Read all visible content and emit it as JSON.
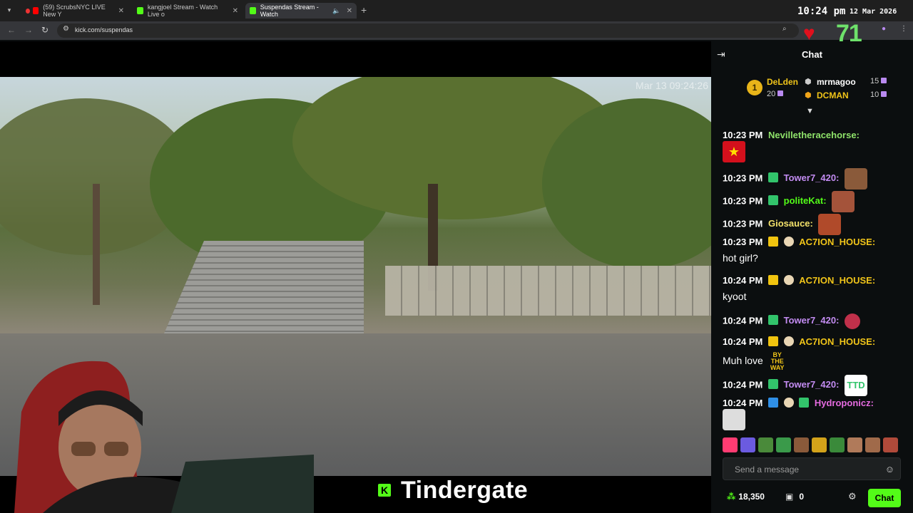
{
  "browser": {
    "tabs": [
      {
        "label": "(59) ScrubsNYC LIVE New Y",
        "icon": "youtube-icon"
      },
      {
        "label": "kangjoel Stream - Watch Live o",
        "icon": "kick-icon"
      },
      {
        "label": "Suspendas Stream - Watch",
        "icon": "kick-icon"
      }
    ],
    "url": "kick.com/suspendas",
    "clock": "10:24 pm",
    "date": "12 Mar 2026"
  },
  "overlay": {
    "viewers": "71",
    "video_timestamp": "Mar 13 09:24:26",
    "banner_text": "Tindergate",
    "colors": {
      "heart": "#e0101d",
      "viewers": "#6ee26b",
      "kick_green": "#53fc18"
    }
  },
  "chat": {
    "title": "Chat",
    "leaderboard": [
      {
        "rank": "1",
        "name": "DeLden",
        "count": "20",
        "color": "#f0c419"
      },
      {
        "name": "mrmagoo",
        "count": "15",
        "color": "#ffffff"
      },
      {
        "name": "DCMAN",
        "count": "10",
        "color": "#f0c419"
      }
    ],
    "messages": [
      {
        "time": "10:23 PM",
        "user": "Nevilletheracehorse:",
        "color": "#8fe36a",
        "text": ""
      },
      {
        "time": "10:23 PM",
        "user": "Tower7_420:",
        "color": "#c38cf2",
        "text": ""
      },
      {
        "time": "10:23 PM",
        "user": "politeKat:",
        "color": "#53fc18",
        "text": ""
      },
      {
        "time": "10:23 PM",
        "user": "Giosauce:",
        "color": "#f2e06a",
        "text": ""
      },
      {
        "time": "10:23 PM",
        "user": "AC7ION_HOUSE:",
        "color": "#f0c419",
        "text": "hot girl?"
      },
      {
        "time": "10:24 PM",
        "user": "AC7ION_HOUSE:",
        "color": "#f0c419",
        "text": "kyoot"
      },
      {
        "time": "10:24 PM",
        "user": "Tower7_420:",
        "color": "#c38cf2",
        "text": ""
      },
      {
        "time": "10:24 PM",
        "user": "AC7ION_HOUSE:",
        "color": "#f0c419",
        "text": "Muh love"
      },
      {
        "time": "10:24 PM",
        "user": "Tower7_420:",
        "color": "#c38cf2",
        "text": ""
      },
      {
        "time": "10:24 PM",
        "user": "Hydroponicz:",
        "color": "#e56be0",
        "text": ""
      }
    ],
    "emote_text": {
      "by_the_way": "BY THE WAY",
      "ttd": "TTD"
    },
    "input_placeholder": "Send a message",
    "points": "18,350",
    "inbox_count": "0",
    "send_label": "Chat"
  }
}
